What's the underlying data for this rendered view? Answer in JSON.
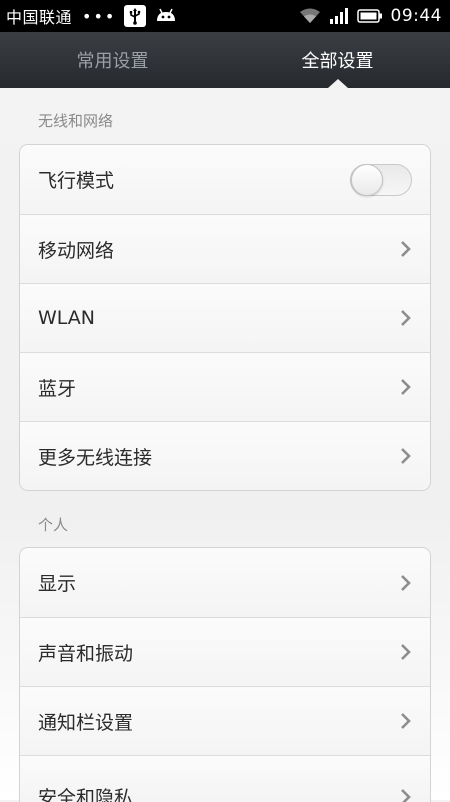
{
  "status_bar": {
    "carrier": "中国联通",
    "dots": "•••",
    "time": "09:44"
  },
  "tabs": [
    {
      "label": "常用设置",
      "active": false
    },
    {
      "label": "全部设置",
      "active": true
    }
  ],
  "sections": [
    {
      "title": "无线和网络",
      "items": [
        {
          "label": "飞行模式",
          "type": "toggle",
          "on": false
        },
        {
          "label": "移动网络",
          "type": "chevron"
        },
        {
          "label": "WLAN",
          "type": "chevron"
        },
        {
          "label": "蓝牙",
          "type": "chevron"
        },
        {
          "label": "更多无线连接",
          "type": "chevron"
        }
      ]
    },
    {
      "title": "个人",
      "items": [
        {
          "label": "显示",
          "type": "chevron"
        },
        {
          "label": "声音和振动",
          "type": "chevron"
        },
        {
          "label": "通知栏设置",
          "type": "chevron"
        },
        {
          "label": "安全和隐私",
          "type": "chevron"
        }
      ]
    }
  ],
  "colors": {
    "header_bg": "#2e3136",
    "tab_active": "#ffffff",
    "tab_inactive": "#9b9fa6"
  }
}
